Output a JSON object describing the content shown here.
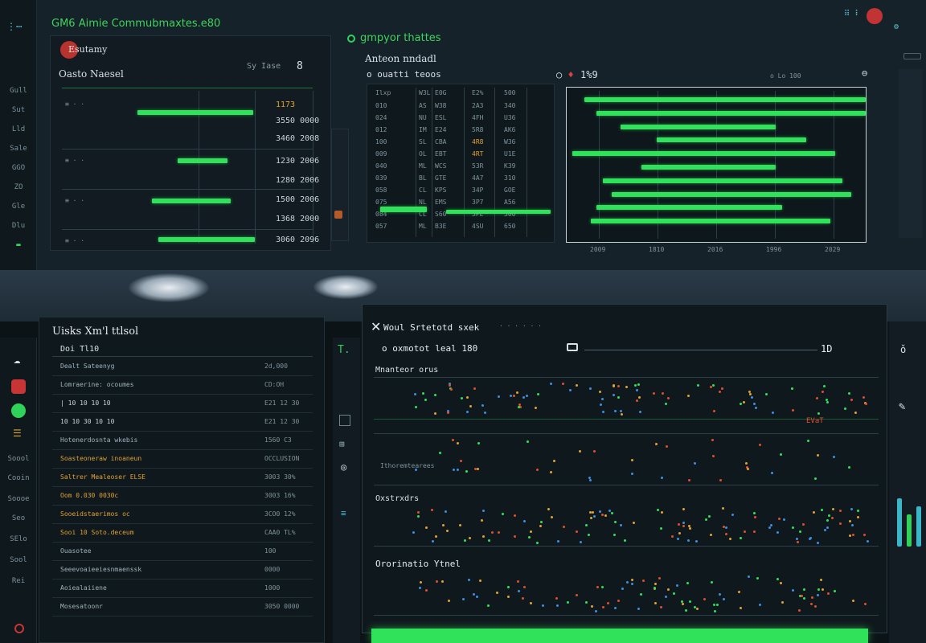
{
  "window_title": "GM6 Aimie  Commubmaxtes.e80",
  "top_left_panel": {
    "logo_text": "Esutamy",
    "title": "Oasto Naesel",
    "rows_right": [
      "1173",
      "3550 0000",
      "3460 2008",
      "1230 2006",
      "1280 2006",
      "1500 2006",
      "1368 2000",
      "3060 2096"
    ],
    "header_right": "Sy Iase"
  },
  "top_mid_panel": {
    "tab_label": "gmpyor thattes",
    "subtitle": "Anteon nndadl",
    "filter_label": "o ouatti teoos",
    "zoom_label": "1%9",
    "search_hint": "o Lo 100"
  },
  "table_cols": [
    "Ilxp",
    "W3L",
    "E0G",
    "E2%",
    "500"
  ],
  "table_rows": [
    [
      "010",
      "AS",
      "W38",
      "2A3",
      "340"
    ],
    [
      "024",
      "NU",
      "ESL",
      "4FH",
      "U36"
    ],
    [
      "012",
      "IM",
      "E24",
      "5R8",
      "AK6"
    ],
    [
      "100",
      "SL",
      "CBA",
      "4R8",
      "W36"
    ],
    [
      "009",
      "OL",
      "EBT",
      "4RT",
      "U1E"
    ],
    [
      "040",
      "ML",
      "WCS",
      "53R",
      "K39"
    ],
    [
      "039",
      "BL",
      "GTE",
      "4A7",
      "310"
    ],
    [
      "058",
      "CL",
      "KPS",
      "34P",
      "GOE"
    ],
    [
      "075",
      "NL",
      "EMS",
      "3P7",
      "A56"
    ],
    [
      "084",
      "CL",
      "S60",
      "3PE",
      "300"
    ],
    [
      "057",
      "ML",
      "B3E",
      "4SU",
      "650"
    ]
  ],
  "gantt": {
    "x_ticks": [
      "2009",
      "1810",
      "2016",
      "1996",
      "2029"
    ],
    "bars": [
      {
        "start": 0.06,
        "end": 1.0
      },
      {
        "start": 0.1,
        "end": 1.0
      },
      {
        "start": 0.18,
        "end": 0.7
      },
      {
        "start": 0.3,
        "end": 0.8
      },
      {
        "start": 0.02,
        "end": 0.9
      },
      {
        "start": 0.25,
        "end": 0.7
      },
      {
        "start": 0.12,
        "end": 0.92
      },
      {
        "start": 0.15,
        "end": 0.95
      },
      {
        "start": 0.1,
        "end": 0.72
      },
      {
        "start": 0.08,
        "end": 0.88
      }
    ]
  },
  "bottom_left_panel": {
    "title": "Uisks Xm'l ttlsol",
    "sub": "Doi Tl10",
    "rows": [
      {
        "label": "Dealt Sateenyg",
        "value": "2d,000"
      },
      {
        "label": "Lomraerine: ocoumes",
        "value": "CD:OH"
      },
      {
        "label": "| 10 10 10 10",
        "value": "E21 12 30"
      },
      {
        "label": "10 10 30 10 10",
        "value": "E21 12 30"
      },
      {
        "label": "Hotenerdosnta wkebis",
        "value": "1560 C3"
      },
      {
        "label": "Soasteoneraw inoaneun",
        "value": "OCCLUSION"
      },
      {
        "label": "Saltrer Mealeoser ELSE",
        "value": "3003 30%"
      },
      {
        "label": "Oom 0.030 0030c",
        "value": "3003 16%"
      },
      {
        "label": "Sooeidstaerimos oc",
        "value": "3CO0 12%"
      },
      {
        "label": "Sooi 10 Soto.deceum",
        "value": "CAA0 TL%"
      },
      {
        "label": "Ouasotee",
        "value": "100"
      },
      {
        "label": "Seeevoaieeiesnmaenssk",
        "value": "0000"
      },
      {
        "label": "Aoiealaiiene",
        "value": "1000"
      },
      {
        "label": "Mosesatoonr",
        "value": "3050 0000"
      }
    ]
  },
  "bottom_right_panel": {
    "title": "Woul Srtetotd sxek",
    "breadcrumb": "o oxmotot leal 180",
    "value_label": "1D",
    "section_1": "Mnanteor orus",
    "section_2": "Oxstrxdrs",
    "section_3": "Ororinatio Ytnel",
    "axis_a": "Ithoremtearees",
    "axis_b": "EVaT"
  },
  "colors": {
    "accent": "#2fe25a",
    "amber": "#e0a233",
    "red": "#e0502e",
    "blue": "#3d8fe0"
  },
  "rail_items_top": [
    "Gull",
    "Sut",
    "Lld",
    "Sale",
    "GGO",
    "ZO",
    "Gle",
    "Dlu"
  ],
  "rail_items_bottom": [
    "Soool",
    "Cooin",
    "Soooe",
    "Seo",
    "SElo",
    "Sool",
    "Rei"
  ]
}
